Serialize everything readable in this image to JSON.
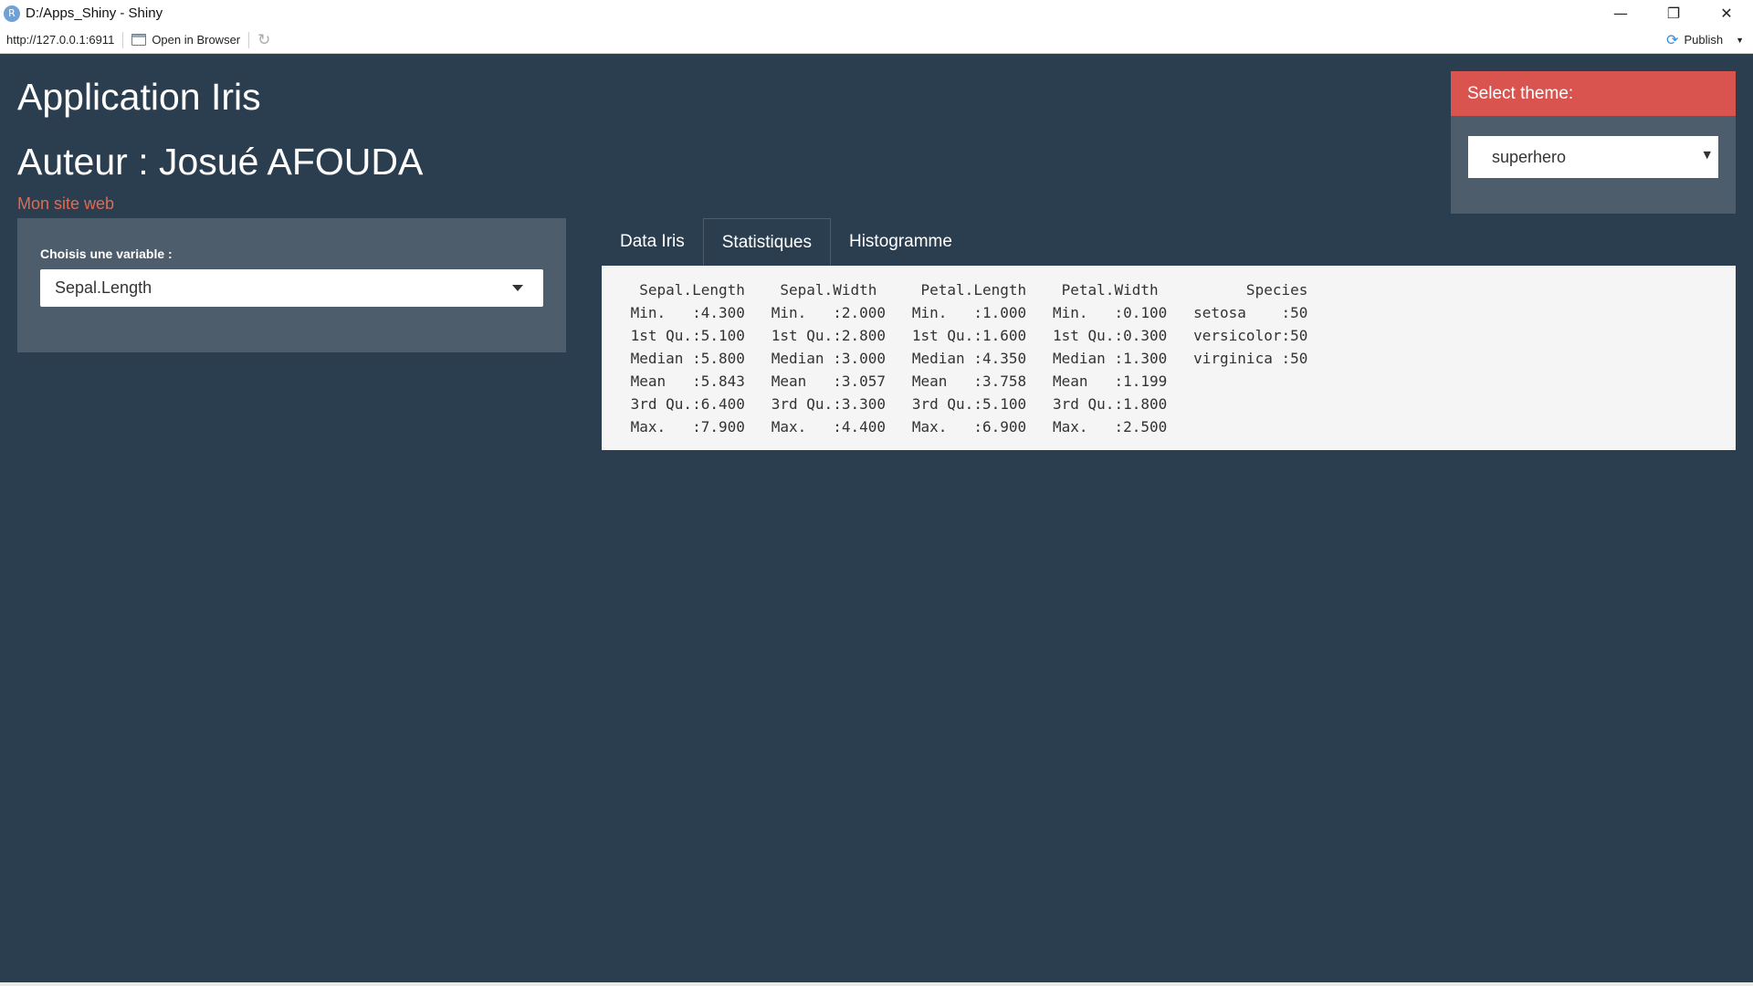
{
  "window": {
    "app_icon_letter": "R",
    "title": "D:/Apps_Shiny - Shiny",
    "controls": {
      "minimize": "—",
      "restore": "❐",
      "close": "✕"
    }
  },
  "toolbar": {
    "url": "http://127.0.0.1:6911",
    "open_in_browser": "Open in Browser",
    "refresh_icon": "↻",
    "publish": "Publish",
    "publish_caret": "▼"
  },
  "app": {
    "title": "Application Iris",
    "author": "Auteur : Josué AFOUDA",
    "site_link": "Mon site web"
  },
  "sidebar": {
    "variable_label": "Choisis une variable :",
    "variable_selected": "Sepal.Length"
  },
  "tabs": [
    {
      "label": "Data Iris",
      "active": false
    },
    {
      "label": "Statistiques",
      "active": true
    },
    {
      "label": "Histogramme",
      "active": false
    }
  ],
  "summary_output": "  Sepal.Length    Sepal.Width     Petal.Length    Petal.Width          Species  \n Min.   :4.300   Min.   :2.000   Min.   :1.000   Min.   :0.100   setosa    :50  \n 1st Qu.:5.100   1st Qu.:2.800   1st Qu.:1.600   1st Qu.:0.300   versicolor:50  \n Median :5.800   Median :3.000   Median :4.350   Median :1.300   virginica :50  \n Mean   :5.843   Mean   :3.057   Mean   :3.758   Mean   :1.199                  \n 3rd Qu.:6.400   3rd Qu.:3.300   3rd Qu.:5.100   3rd Qu.:1.800                  \n Max.   :7.900   Max.   :4.400   Max.   :6.900   Max.   :2.500                  ",
  "theme_selector": {
    "header": "Select theme:",
    "selected": "superhero",
    "caret": "▼"
  },
  "colors": {
    "background": "#2b3e50",
    "panel": "#4e5d6c",
    "accent_link": "#df6b53",
    "theme_header": "#d9534f"
  }
}
